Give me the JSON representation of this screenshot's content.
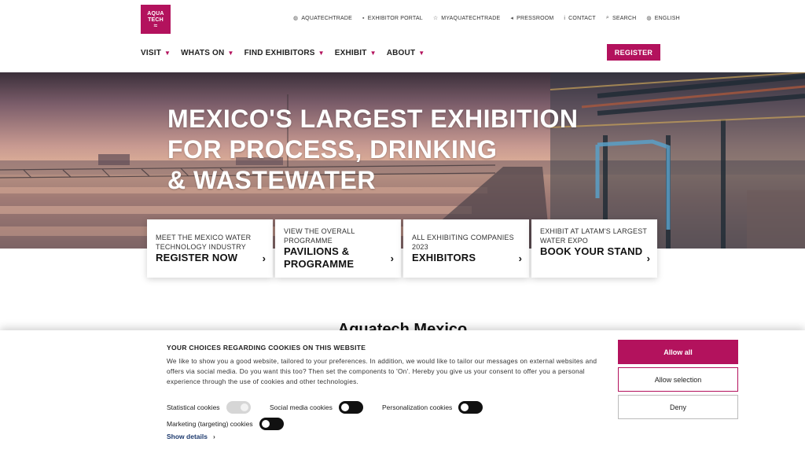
{
  "logo": {
    "line1": "AQUA",
    "line2": "TECH",
    "waves": "≈"
  },
  "util_nav": [
    {
      "icon": "globe-icon",
      "glyph": "◍",
      "label": "AQUATECHTRADE"
    },
    {
      "icon": "lock-icon",
      "glyph": "▪",
      "label": "EXHIBITOR PORTAL"
    },
    {
      "icon": "star-icon",
      "glyph": "☆",
      "label": "MYAQUATECHTRADE"
    },
    {
      "icon": "megaphone-icon",
      "glyph": "◂",
      "label": "PRESSROOM"
    },
    {
      "icon": "info-icon",
      "glyph": "i",
      "label": "CONTACT"
    },
    {
      "icon": "search-icon",
      "glyph": "⌕",
      "label": "SEARCH"
    },
    {
      "icon": "language-globe-icon",
      "glyph": "◍",
      "label": "ENGLISH"
    }
  ],
  "main_nav": [
    {
      "label": "VISIT"
    },
    {
      "label": "WHATS ON"
    },
    {
      "label": "FIND EXHIBITORS"
    },
    {
      "label": "EXHIBIT"
    },
    {
      "label": "ABOUT"
    }
  ],
  "register_button": "REGISTER",
  "hero": {
    "line1": "MEXICO'S LARGEST EXHIBITION",
    "line2": "FOR PROCESS, DRINKING",
    "line3": "& WASTEWATER"
  },
  "cards": [
    {
      "small": "MEET THE MEXICO WATER TECHNOLOGY INDUSTRY",
      "big": "REGISTER NOW"
    },
    {
      "small": "VIEW THE OVERALL PROGRAMME",
      "big": "PAVILIONS & PROGRAMME"
    },
    {
      "small": "ALL EXHIBITING COMPANIES 2023",
      "big": "EXHIBITORS"
    },
    {
      "small": "EXHIBIT AT LATAM'S LARGEST WATER EXPO",
      "big": "BOOK YOUR STAND"
    }
  ],
  "section_title": "Aquatech Mexico",
  "cookie": {
    "title": "YOUR CHOICES REGARDING COOKIES ON THIS WEBSITE",
    "text": "We like to show you a good website, tailored to your preferences. In addition, we would like to tailor our messages on external websites and offers via social media. Do you want this too? Then set the components to 'On'. Hereby you give us your consent to offer you a personal experience through the use of cookies and other technologies.",
    "toggles": {
      "statistical": "Statistical cookies",
      "social": "Social media cookies",
      "personalization": "Personalization cookies",
      "marketing": "Marketing (targeting) cookies"
    },
    "show_details": "Show details",
    "allow_all": "Allow all",
    "allow_selection": "Allow selection",
    "deny": "Deny"
  },
  "colors": {
    "brand": "#b3125d",
    "link": "#1d3a6e"
  }
}
